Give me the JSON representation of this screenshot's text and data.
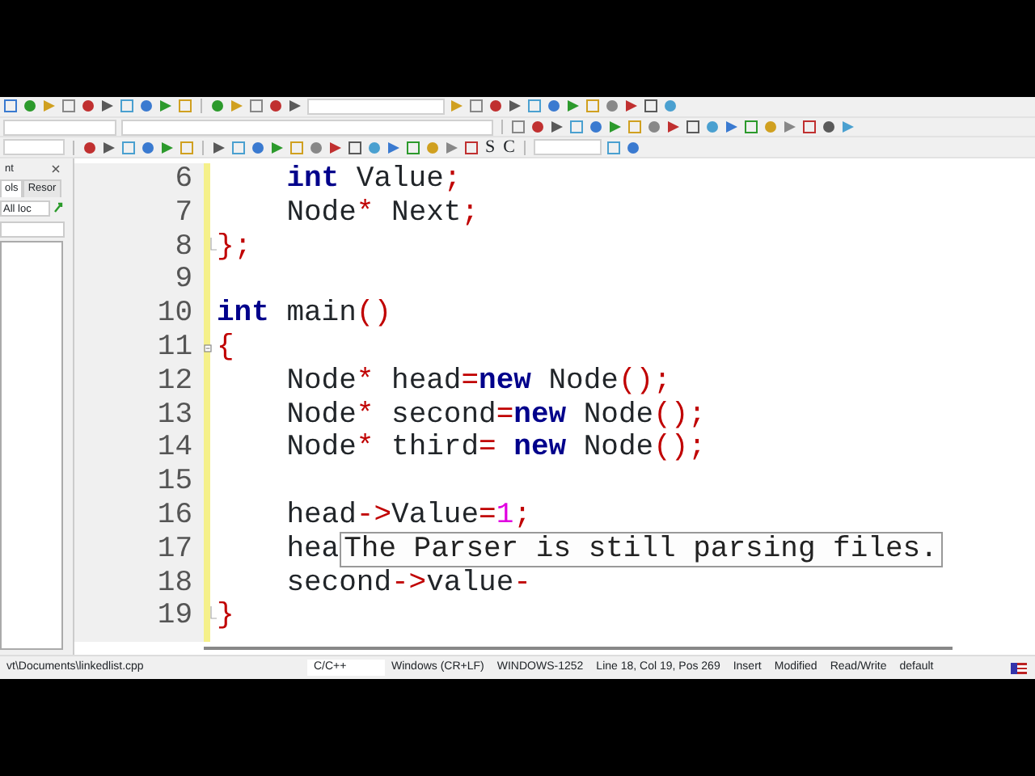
{
  "toolbar": {
    "text_buttons": [
      "S",
      "C"
    ]
  },
  "left_panel": {
    "title": "nt",
    "tabs": [
      {
        "label": "ols",
        "selected": true
      },
      {
        "label": "Resor",
        "selected": false
      }
    ],
    "filter": "All loc"
  },
  "editor": {
    "lines": [
      {
        "number": "6",
        "indented": true,
        "tokens": [
          {
            "kind": "keyword",
            "text": "int"
          },
          {
            "kind": "plain",
            "text": " Value"
          },
          {
            "kind": "operator",
            "text": ";"
          }
        ]
      },
      {
        "number": "7",
        "indented": true,
        "tokens": [
          {
            "kind": "plain",
            "text": "Node"
          },
          {
            "kind": "operator",
            "text": "*"
          },
          {
            "kind": "plain",
            "text": " Next"
          },
          {
            "kind": "operator",
            "text": ";"
          }
        ]
      },
      {
        "number": "8",
        "fold_end": true,
        "tokens": [
          {
            "kind": "operator",
            "text": "};"
          }
        ]
      },
      {
        "number": "9"
      },
      {
        "number": "10",
        "tokens": [
          {
            "kind": "keyword",
            "text": "int"
          },
          {
            "kind": "plain",
            "text": " main"
          },
          {
            "kind": "operator",
            "text": "()"
          }
        ]
      },
      {
        "number": "11",
        "fold_start": true,
        "tokens": [
          {
            "kind": "operator",
            "text": "{"
          }
        ]
      },
      {
        "number": "12",
        "indented": true,
        "tokens": [
          {
            "kind": "plain",
            "text": "Node"
          },
          {
            "kind": "operator",
            "text": "*"
          },
          {
            "kind": "plain",
            "text": " head"
          },
          {
            "kind": "operator",
            "text": "="
          },
          {
            "kind": "keyword",
            "text": "new"
          },
          {
            "kind": "plain",
            "text": " Node"
          },
          {
            "kind": "operator",
            "text": "();"
          }
        ]
      },
      {
        "number": "13",
        "indented": true,
        "tokens": [
          {
            "kind": "plain",
            "text": "Node"
          },
          {
            "kind": "operator",
            "text": "*"
          },
          {
            "kind": "plain",
            "text": " second"
          },
          {
            "kind": "operator",
            "text": "="
          },
          {
            "kind": "keyword",
            "text": "new"
          },
          {
            "kind": "plain",
            "text": " Node"
          },
          {
            "kind": "operator",
            "text": "();"
          }
        ]
      },
      {
        "number": "14",
        "indented": true,
        "tokens": [
          {
            "kind": "plain",
            "text": "Node"
          },
          {
            "kind": "operator",
            "text": "*"
          },
          {
            "kind": "plain",
            "text": " third"
          },
          {
            "kind": "operator",
            "text": "= "
          },
          {
            "kind": "keyword",
            "text": "new"
          },
          {
            "kind": "plain",
            "text": " Node"
          },
          {
            "kind": "operator",
            "text": "();"
          }
        ]
      },
      {
        "number": "15"
      },
      {
        "number": "16",
        "indented": true,
        "tokens": [
          {
            "kind": "plain",
            "text": "head"
          },
          {
            "kind": "operator",
            "text": "->"
          },
          {
            "kind": "plain",
            "text": "Value"
          },
          {
            "kind": "operator",
            "text": "="
          },
          {
            "kind": "number",
            "text": "1"
          },
          {
            "kind": "operator",
            "text": ";"
          }
        ]
      },
      {
        "number": "17",
        "indented": true,
        "tokens": [
          {
            "kind": "plain",
            "text": "hea"
          }
        ],
        "tooltip": "The Parser is still parsing files."
      },
      {
        "number": "18",
        "indented": true,
        "tokens": [
          {
            "kind": "plain",
            "text": "second"
          },
          {
            "kind": "operator",
            "text": "->"
          },
          {
            "kind": "plain",
            "text": "value"
          },
          {
            "kind": "operator",
            "text": "-"
          }
        ]
      },
      {
        "number": "19",
        "fold_end": true,
        "tokens": [
          {
            "kind": "operator",
            "text": "}"
          }
        ]
      }
    ]
  },
  "status_bar": {
    "items": [
      "vt\\Documents\\linkedlist.cpp",
      "C/C++",
      "Windows (CR+LF)",
      "WINDOWS-1252",
      "Line 18, Col 19, Pos 269",
      "Insert",
      "Modified",
      "Read/Write",
      "default"
    ]
  }
}
